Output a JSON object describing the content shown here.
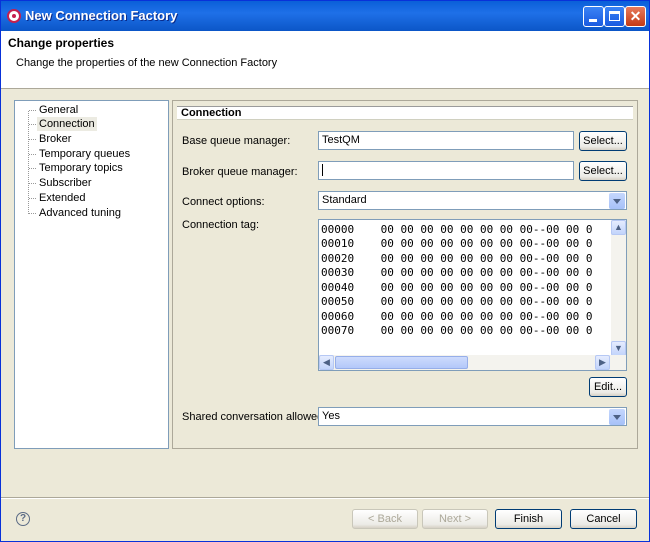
{
  "window": {
    "title": "New Connection Factory"
  },
  "header": {
    "title": "Change properties",
    "subtitle": "Change the properties of the new Connection Factory"
  },
  "tree": {
    "items": [
      "General",
      "Connection",
      "Broker",
      "Temporary queues",
      "Temporary topics",
      "Subscriber",
      "Extended",
      "Advanced tuning"
    ],
    "selected": "Connection"
  },
  "connection": {
    "group_title": "Connection",
    "base_qm_label": "Base queue manager:",
    "base_qm_value": "TestQM",
    "broker_qm_label": "Broker queue manager:",
    "broker_qm_value": "",
    "select_label": "Select...",
    "connect_options_label": "Connect options:",
    "connect_options_value": "Standard",
    "connection_tag_label": "Connection tag:",
    "hex_rows": [
      "00000    00 00 00 00 00 00 00 00--00 00 0",
      "00010    00 00 00 00 00 00 00 00--00 00 0",
      "00020    00 00 00 00 00 00 00 00--00 00 0",
      "00030    00 00 00 00 00 00 00 00--00 00 0",
      "00040    00 00 00 00 00 00 00 00--00 00 0",
      "00050    00 00 00 00 00 00 00 00--00 00 0",
      "00060    00 00 00 00 00 00 00 00--00 00 0",
      "00070    00 00 00 00 00 00 00 00--00 00 0"
    ],
    "edit_label": "Edit...",
    "shared_conv_label": "Shared conversation allowed:",
    "shared_conv_value": "Yes"
  },
  "footer": {
    "back_label": "< Back",
    "next_label": "Next >",
    "finish_label": "Finish",
    "cancel_label": "Cancel"
  },
  "icons": {
    "help": "help-icon",
    "app": "connection-factory-icon"
  }
}
